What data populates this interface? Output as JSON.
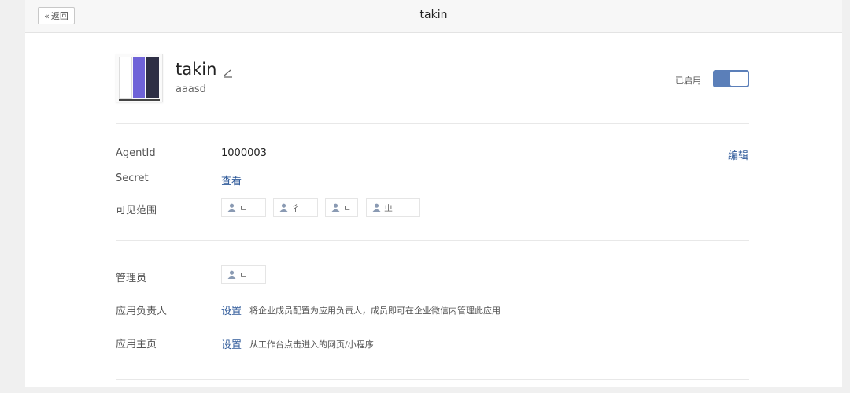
{
  "topbar": {
    "back_label": "返回",
    "title": "takin"
  },
  "app": {
    "name": "takin",
    "description": "aaasd",
    "status_label": "已启用",
    "enabled": true
  },
  "fields": {
    "agentid_label": "AgentId",
    "agentid_value": "1000003",
    "edit_label": "编辑",
    "secret_label": "Secret",
    "secret_link": "查看",
    "scope_label": "可见范围",
    "scope_members": [
      "ㄴ",
      "彳",
      "ㄴ",
      "ㄓ"
    ],
    "admin_label": "管理员",
    "admin_members": [
      "ㄷ"
    ],
    "owner_label": "应用负责人",
    "owner_link": "设置",
    "owner_desc": "将企业成员配置为应用负责人，成员即可在企业微信内管理此应用",
    "homepage_label": "应用主页",
    "homepage_link": "设置",
    "homepage_desc": "从工作台点击进入的网页/小程序"
  },
  "colors": {
    "accent": "#2f5a9a",
    "toggle_on": "#5b7fb9"
  },
  "icons": [
    "back-chevron-icon",
    "pencil-edit-icon",
    "person-icon"
  ]
}
